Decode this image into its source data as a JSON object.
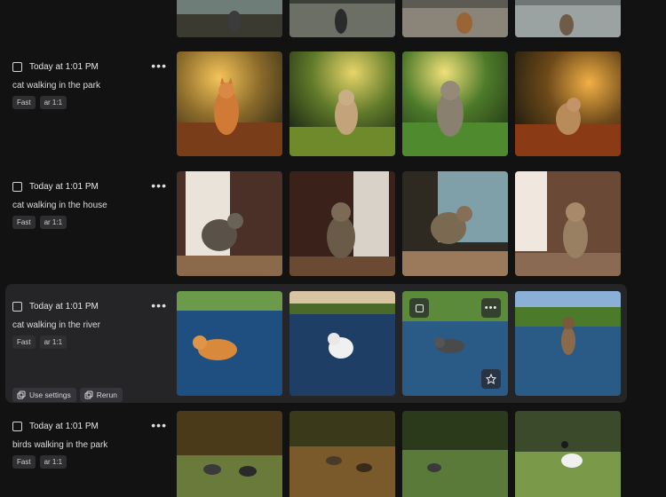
{
  "rows": [
    {
      "timestamp": "Today at 1:01 PM",
      "prompt": "cat walking in the park",
      "tags": [
        "Fast",
        "ar 1:1"
      ],
      "scene": "park"
    },
    {
      "timestamp": "Today at 1:01 PM",
      "prompt": "cat walking in the house",
      "tags": [
        "Fast",
        "ar 1:1"
      ],
      "scene": "house"
    },
    {
      "timestamp": "Today at 1:01 PM",
      "prompt": "cat walking in the river",
      "tags": [
        "Fast",
        "ar 1:1"
      ],
      "scene": "river",
      "actions": [
        "Use settings",
        "Rerun"
      ]
    },
    {
      "timestamp": "Today at 1:01 PM",
      "prompt": "birds walking in the park",
      "tags": [
        "Fast",
        "ar 1:1"
      ],
      "scene": "birds"
    }
  ],
  "more_label": "•••",
  "icons": {
    "checkbox": "checkbox-icon",
    "more": "more-horizontal-icon",
    "use_settings": "copy-settings-icon",
    "rerun": "rerun-icon",
    "select": "select-square-icon",
    "favorite": "star-icon"
  }
}
